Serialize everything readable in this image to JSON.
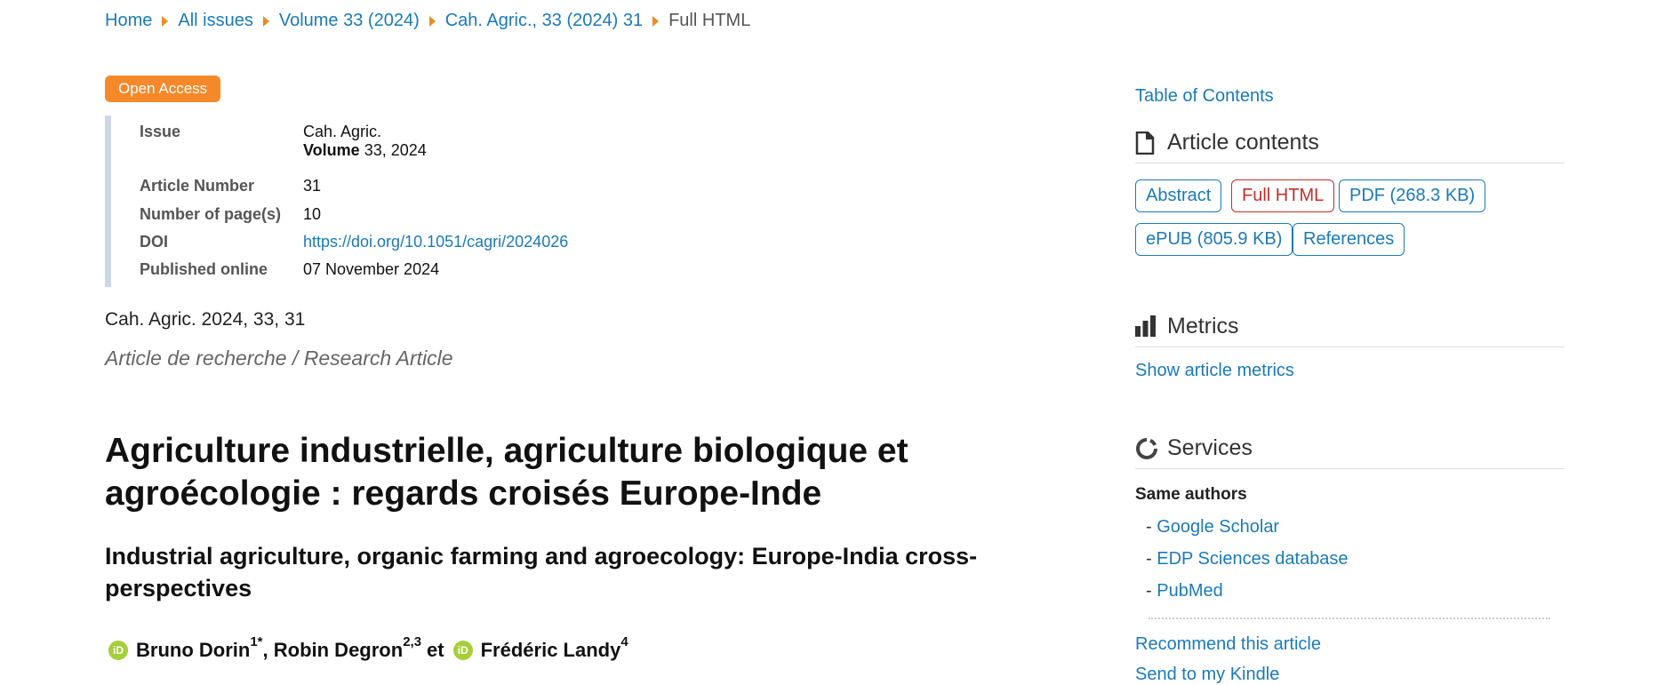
{
  "breadcrumb": {
    "items": [
      "Home",
      "All issues",
      "Volume 33 (2024)",
      "Cah. Agric., 33 (2024) 31"
    ],
    "current": "Full HTML"
  },
  "badge": "Open Access",
  "info": {
    "issue_label": "Issue",
    "issue_journal": "Cah. Agric.",
    "volume_label": "Volume",
    "volume_value": "33, 2024",
    "article_number_label": "Article Number",
    "article_number": "31",
    "pages_label": "Number of page(s)",
    "pages": "10",
    "doi_label": "DOI",
    "doi": "https://doi.org/10.1051/cagri/2024026",
    "published_label": "Published online",
    "published": "07 November 2024"
  },
  "citation": "Cah. Agric. 2024, 33, 31",
  "article_type": "Article de recherche / Research Article",
  "title_fr": "Agriculture industrielle, agriculture biologique et agroécologie : regards croisés Europe-Inde",
  "title_en": "Industrial agriculture, organic farming and agroecology: Europe-India cross-perspectives",
  "authors": {
    "a1": "Bruno Dorin",
    "a1_sup": "1*",
    "a2": "Robin Degron",
    "a2_sup": "2,3",
    "conj": "et",
    "a3": "Frédéric Landy",
    "a3_sup": "4",
    "orcid": "iD"
  },
  "sidebar": {
    "toc": "Table of Contents",
    "contents_head": "Article contents",
    "buttons": [
      "Abstract",
      "Full HTML",
      "PDF (268.3 KB)",
      "ePUB (805.9 KB)",
      "References"
    ],
    "metrics_head": "Metrics",
    "metrics_link": "Show article metrics",
    "services_head": "Services",
    "same_authors": "Same authors",
    "services": [
      "Google Scholar",
      "EDP Sciences database",
      "PubMed"
    ],
    "dash": "-",
    "recommend": "Recommend this article",
    "kindle": "Send to my Kindle"
  },
  "colors": {
    "accent": "#1a7ab8",
    "badge": "#f5892a",
    "active": "#c0302a",
    "orcid": "#a6ce39"
  }
}
